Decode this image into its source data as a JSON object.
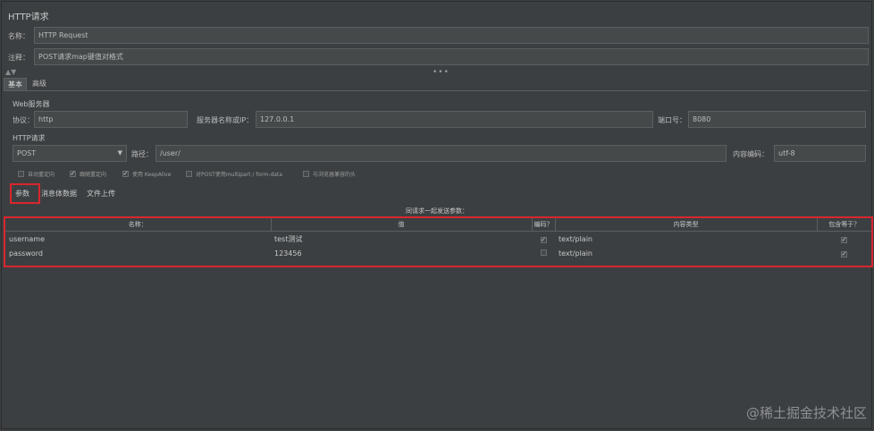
{
  "window": {
    "title": "HTTP请求"
  },
  "name_row": {
    "label": "名称：",
    "value": "HTTP Request"
  },
  "comment_row": {
    "label": "注释：",
    "value": "POST请求map键值对格式"
  },
  "divider": {
    "dots": "•••",
    "arrow": "▲▼"
  },
  "tabs": {
    "basic": "基本",
    "advanced": "高级"
  },
  "web_server": {
    "section": "Web服务器",
    "protocol_label": "协议：",
    "protocol_value": "http",
    "server_label": "服务器名称或IP：",
    "server_value": "127.0.0.1",
    "port_label": "端口号：",
    "port_value": "8080"
  },
  "http_request": {
    "section": "HTTP请求",
    "method_value": "POST",
    "path_label": "路径：",
    "path_value": "/user/",
    "encoding_label": "内容编码：",
    "encoding_value": "utf-8"
  },
  "options": [
    {
      "label": "自动重定向",
      "checked": false
    },
    {
      "label": "跟随重定向",
      "checked": true
    },
    {
      "label": "使用 KeepAlive",
      "checked": true
    },
    {
      "label": "对POST使用multipart / form-data",
      "checked": false
    },
    {
      "label": "与浏览器兼容的头",
      "checked": false
    }
  ],
  "subtabs": {
    "params": "参数",
    "body": "消息体数据",
    "files": "文件上传"
  },
  "params_caption": "同请求一起发送参数：",
  "table": {
    "headers": [
      "名称：",
      "值",
      "编码？",
      "内容类型",
      "包含等于？"
    ],
    "rows": [
      {
        "name": "username",
        "value": "test测试",
        "encode": true,
        "content_type": "text/plain",
        "include_equals": true
      },
      {
        "name": "password",
        "value": "123456",
        "encode": false,
        "content_type": "text/plain",
        "include_equals": true
      }
    ]
  },
  "watermark": "@稀土掘金技术社区"
}
